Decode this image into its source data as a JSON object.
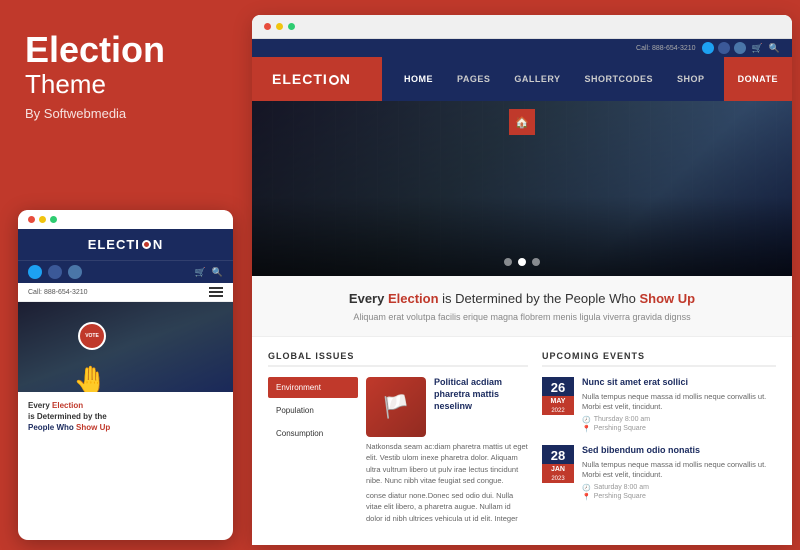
{
  "left": {
    "title": "Election",
    "subtitle": "Theme",
    "author": "By Softwebmedia",
    "mobile": {
      "logo": "ELECTI",
      "logo_o": "O",
      "logo_n": "N",
      "call_text": "Call: 888-654-3210",
      "vote_text": "VOTE",
      "tagline_every": "Every",
      "tagline_election": "Election",
      "tagline_determined": "is Determined by the",
      "tagline_people": "People Who",
      "tagline_show": "Show Up"
    }
  },
  "browser": {
    "dots": [
      "red",
      "yellow",
      "green"
    ],
    "utility_bar": {
      "phone": "Call: 888-654-3210"
    },
    "nav": {
      "logo": "ELECTI",
      "logo_o": "O",
      "logo_n": "N",
      "items": [
        "HOME",
        "PAGES",
        "GALLERY",
        "SHORTCODES",
        "SHOP"
      ],
      "donate": "DONATE"
    },
    "tagline": {
      "every": "Every",
      "election": "Election",
      "middle": " is Determined by the People Who ",
      "show_up": "Show Up",
      "sub": "Aliquam erat volutpa facilis erique magna flobrem menis ligula viverra gravida dignss"
    },
    "global_issues": {
      "section_title": "GLOBAL ISSUES",
      "items": [
        "Environment",
        "Population",
        "Consumption"
      ],
      "active_item": "Environment",
      "article": {
        "title": "Political acdiam pharetra mattis neselinw",
        "body": "Natkonsda seam ac:diam pharetra mattis ut eget elit. Vestib ulom inexe pharetra dolor. Aliquam ultra vultrum libero ut pulv irae lectus tincidunt nibe. Nunc nibh vitae feugiat sed congue.",
        "more": "conse diatur none.Donec sed odio dui. Nulla vitae elit libero, a pharetra augue. Nullam id dolor id nibh ultrices vehicula ut id elit. Integer"
      }
    },
    "upcoming_events": {
      "section_title": "UPCOMING EVENTS",
      "events": [
        {
          "day": "26",
          "month": "MAY",
          "year": "2022",
          "title": "Nunc sit amet erat sollici",
          "desc": "Nulla tempus neque massa id mollis neque convallis ut. Morbi est velit, tincidunt.",
          "meta": [
            "Thursday  8:00 am",
            "Pershing Square"
          ]
        },
        {
          "day": "28",
          "month": "JAN",
          "year": "2023",
          "title": "Sed bibendum odio nonatis",
          "desc": "Nulla tempus neque massa id mollis neque convallis ut. Morbi est velit, tincidunt.",
          "meta": [
            "Saturday  8:00 am",
            "Pershing Square"
          ]
        }
      ]
    }
  }
}
